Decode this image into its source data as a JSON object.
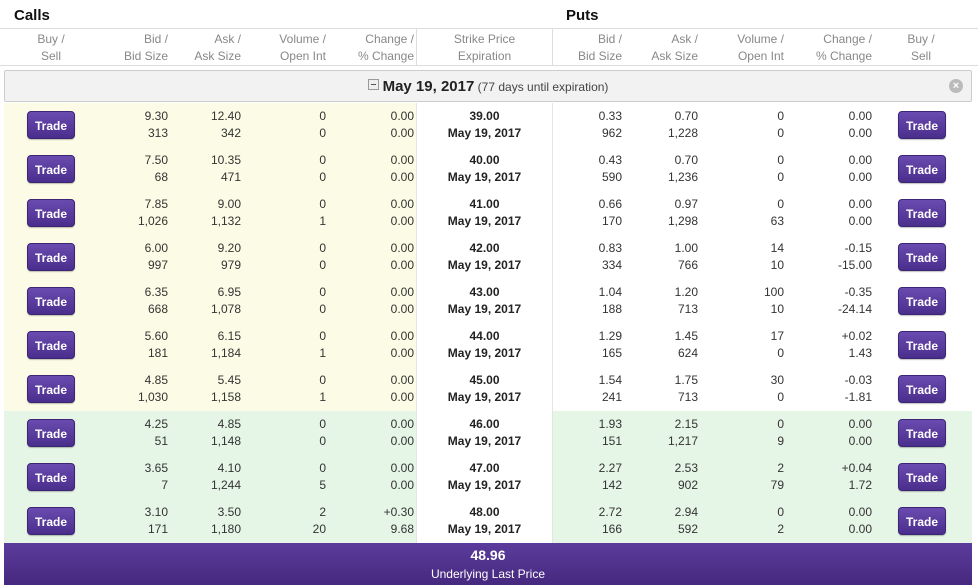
{
  "header": {
    "calls_title": "Calls",
    "puts_title": "Puts"
  },
  "columns": {
    "call_buy_sell": [
      "Buy /",
      "Sell"
    ],
    "call_bid": [
      "Bid /",
      "Bid Size"
    ],
    "call_ask": [
      "Ask /",
      "Ask Size"
    ],
    "call_volume": [
      "Volume /",
      "Open Int"
    ],
    "call_change": [
      "Change /",
      "% Change"
    ],
    "strike": [
      "Strike Price",
      "Expiration"
    ],
    "put_bid": [
      "Bid /",
      "Bid Size"
    ],
    "put_ask": [
      "Ask /",
      "Ask Size"
    ],
    "put_volume": [
      "Volume /",
      "Open Int"
    ],
    "put_change": [
      "Change /",
      "% Change"
    ],
    "put_buy_sell": [
      "Buy /",
      "Sell"
    ]
  },
  "expiration": {
    "date": "May 19, 2017",
    "note": "(77 days until expiration)",
    "collapse_icon": "collapse-icon",
    "close_icon": "close-icon"
  },
  "trade_label": "Trade",
  "rows": [
    {
      "zone": "otm",
      "call": {
        "bid": "9.30",
        "bid_size": "313",
        "ask": "12.40",
        "ask_size": "342",
        "volume": "0",
        "open_int": "0",
        "change": "0.00",
        "pct_change": "0.00"
      },
      "strike": "39.00",
      "expiration": "May 19, 2017",
      "put": {
        "bid": "0.33",
        "bid_size": "962",
        "ask": "0.70",
        "ask_size": "1,228",
        "volume": "0",
        "open_int": "0",
        "change": "0.00",
        "pct_change": "0.00"
      }
    },
    {
      "zone": "otm",
      "call": {
        "bid": "7.50",
        "bid_size": "68",
        "ask": "10.35",
        "ask_size": "471",
        "volume": "0",
        "open_int": "0",
        "change": "0.00",
        "pct_change": "0.00"
      },
      "strike": "40.00",
      "expiration": "May 19, 2017",
      "put": {
        "bid": "0.43",
        "bid_size": "590",
        "ask": "0.70",
        "ask_size": "1,236",
        "volume": "0",
        "open_int": "0",
        "change": "0.00",
        "pct_change": "0.00"
      }
    },
    {
      "zone": "otm",
      "call": {
        "bid": "7.85",
        "bid_size": "1,026",
        "ask": "9.00",
        "ask_size": "1,132",
        "volume": "0",
        "open_int": "1",
        "change": "0.00",
        "pct_change": "0.00"
      },
      "strike": "41.00",
      "expiration": "May 19, 2017",
      "put": {
        "bid": "0.66",
        "bid_size": "170",
        "ask": "0.97",
        "ask_size": "1,298",
        "volume": "0",
        "open_int": "63",
        "change": "0.00",
        "pct_change": "0.00"
      }
    },
    {
      "zone": "otm",
      "call": {
        "bid": "6.00",
        "bid_size": "997",
        "ask": "9.20",
        "ask_size": "979",
        "volume": "0",
        "open_int": "0",
        "change": "0.00",
        "pct_change": "0.00"
      },
      "strike": "42.00",
      "expiration": "May 19, 2017",
      "put": {
        "bid": "0.83",
        "bid_size": "334",
        "ask": "1.00",
        "ask_size": "766",
        "volume": "14",
        "open_int": "10",
        "change": "-0.15",
        "pct_change": "-15.00"
      }
    },
    {
      "zone": "otm",
      "call": {
        "bid": "6.35",
        "bid_size": "668",
        "ask": "6.95",
        "ask_size": "1,078",
        "volume": "0",
        "open_int": "0",
        "change": "0.00",
        "pct_change": "0.00"
      },
      "strike": "43.00",
      "expiration": "May 19, 2017",
      "put": {
        "bid": "1.04",
        "bid_size": "188",
        "ask": "1.20",
        "ask_size": "713",
        "volume": "100",
        "open_int": "10",
        "change": "-0.35",
        "pct_change": "-24.14"
      }
    },
    {
      "zone": "otm",
      "call": {
        "bid": "5.60",
        "bid_size": "181",
        "ask": "6.15",
        "ask_size": "1,184",
        "volume": "0",
        "open_int": "1",
        "change": "0.00",
        "pct_change": "0.00"
      },
      "strike": "44.00",
      "expiration": "May 19, 2017",
      "put": {
        "bid": "1.29",
        "bid_size": "165",
        "ask": "1.45",
        "ask_size": "624",
        "volume": "17",
        "open_int": "0",
        "change": "+0.02",
        "pct_change": "1.43"
      }
    },
    {
      "zone": "otm",
      "call": {
        "bid": "4.85",
        "bid_size": "1,030",
        "ask": "5.45",
        "ask_size": "1,158",
        "volume": "0",
        "open_int": "1",
        "change": "0.00",
        "pct_change": "0.00"
      },
      "strike": "45.00",
      "expiration": "May 19, 2017",
      "put": {
        "bid": "1.54",
        "bid_size": "241",
        "ask": "1.75",
        "ask_size": "713",
        "volume": "30",
        "open_int": "0",
        "change": "-0.03",
        "pct_change": "-1.81"
      }
    },
    {
      "zone": "itm",
      "call": {
        "bid": "4.25",
        "bid_size": "51",
        "ask": "4.85",
        "ask_size": "1,148",
        "volume": "0",
        "open_int": "0",
        "change": "0.00",
        "pct_change": "0.00"
      },
      "strike": "46.00",
      "expiration": "May 19, 2017",
      "put": {
        "bid": "1.93",
        "bid_size": "151",
        "ask": "2.15",
        "ask_size": "1,217",
        "volume": "0",
        "open_int": "9",
        "change": "0.00",
        "pct_change": "0.00"
      }
    },
    {
      "zone": "itm",
      "call": {
        "bid": "3.65",
        "bid_size": "7",
        "ask": "4.10",
        "ask_size": "1,244",
        "volume": "0",
        "open_int": "5",
        "change": "0.00",
        "pct_change": "0.00"
      },
      "strike": "47.00",
      "expiration": "May 19, 2017",
      "put": {
        "bid": "2.27",
        "bid_size": "142",
        "ask": "2.53",
        "ask_size": "902",
        "volume": "2",
        "open_int": "79",
        "change": "+0.04",
        "pct_change": "1.72"
      }
    },
    {
      "zone": "itm",
      "call": {
        "bid": "3.10",
        "bid_size": "171",
        "ask": "3.50",
        "ask_size": "1,180",
        "volume": "2",
        "open_int": "20",
        "change": "+0.30",
        "pct_change": "9.68"
      },
      "strike": "48.00",
      "expiration": "May 19, 2017",
      "put": {
        "bid": "2.72",
        "bid_size": "166",
        "ask": "2.94",
        "ask_size": "592",
        "volume": "0",
        "open_int": "2",
        "change": "0.00",
        "pct_change": "0.00"
      }
    }
  ],
  "footer": {
    "price": "48.96",
    "label": "Underlying Last Price"
  },
  "colors": {
    "trade_button": "#4a2e8c",
    "footer": "#4f3290",
    "calls_otm_bg": "#fcfce6",
    "itm_bg": "#e5f5e6"
  }
}
